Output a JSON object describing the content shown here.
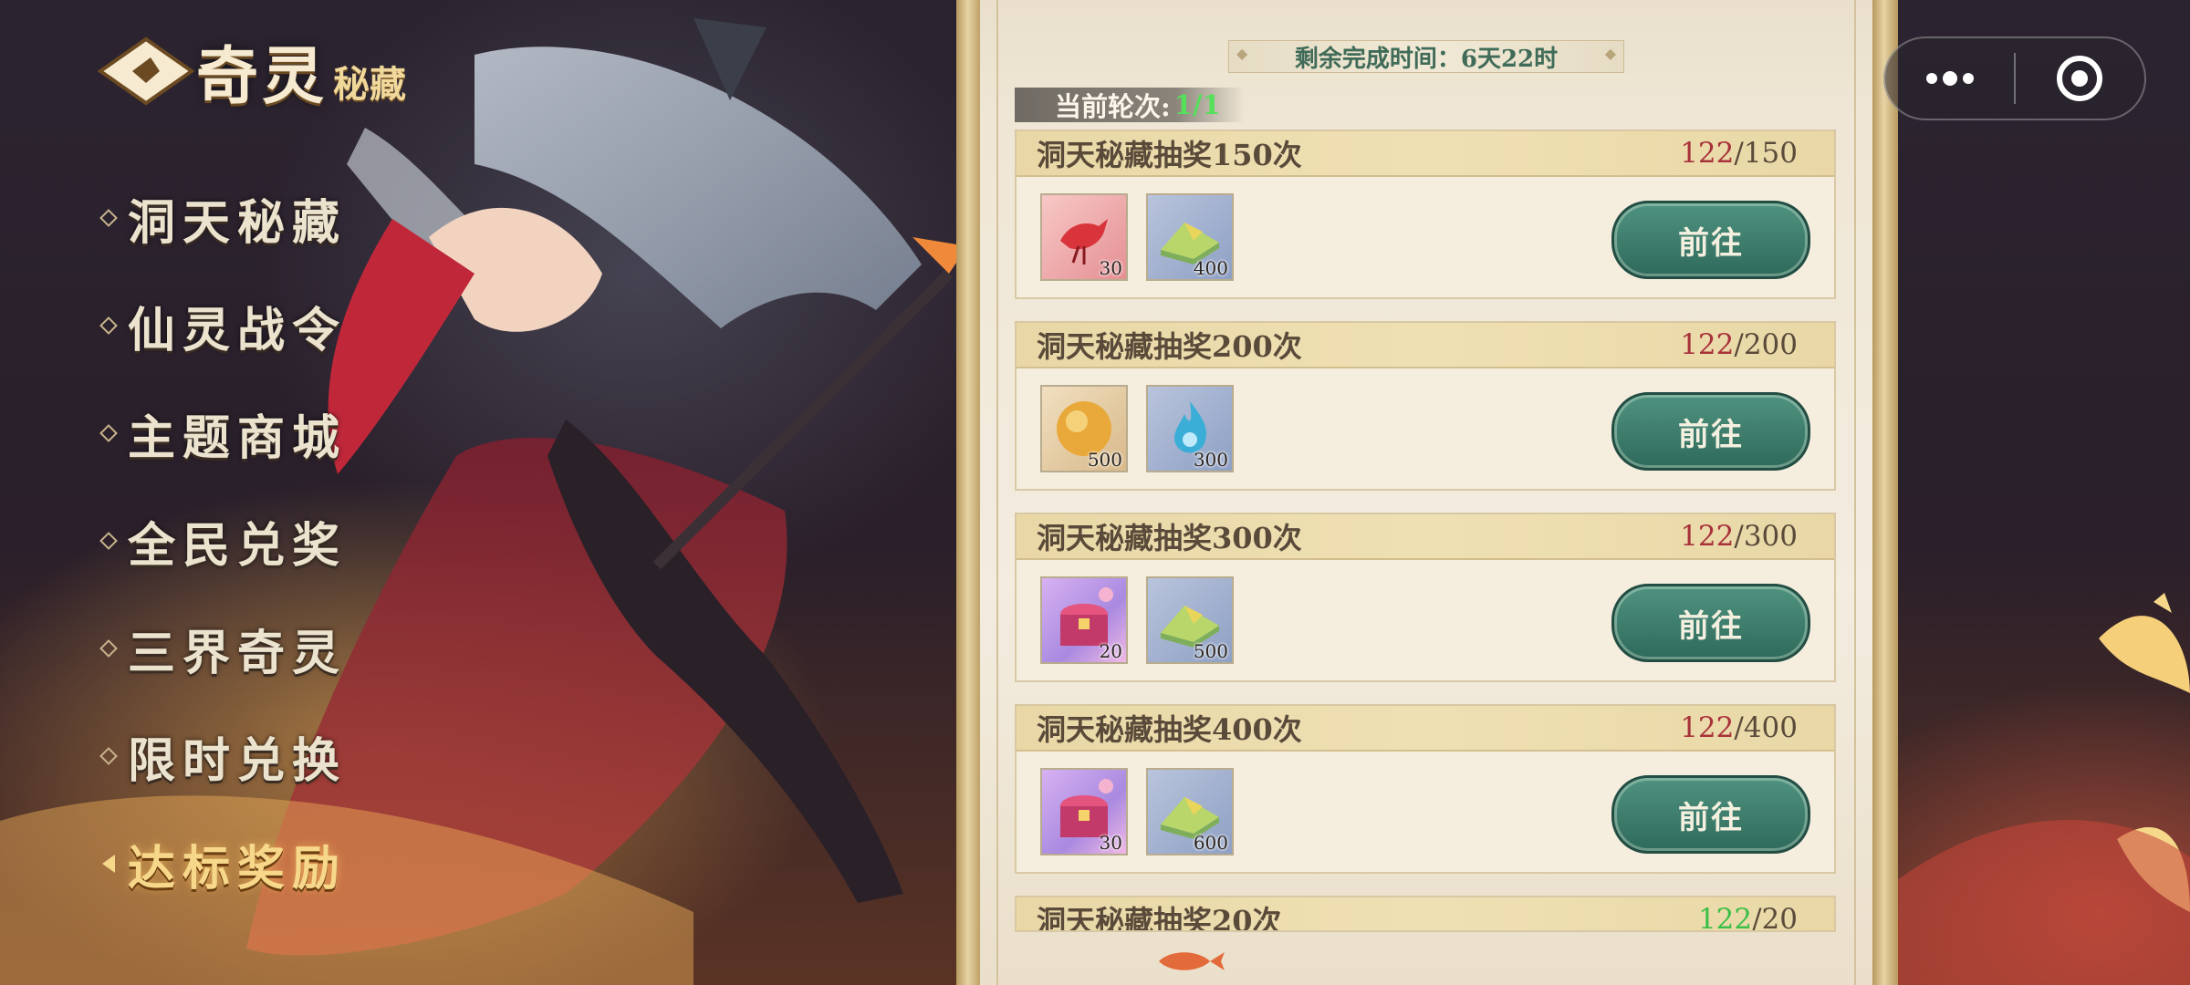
{
  "logo": {
    "title": "奇灵",
    "subtitle": "秘藏"
  },
  "menu": [
    {
      "label": "洞天秘藏",
      "active": false
    },
    {
      "label": "仙灵战令",
      "active": false
    },
    {
      "label": "主题商城",
      "active": false
    },
    {
      "label": "全民兑奖",
      "active": false
    },
    {
      "label": "三界奇灵",
      "active": false
    },
    {
      "label": "限时兑换",
      "active": false
    },
    {
      "label": "达标奖励",
      "active": true
    }
  ],
  "panel": {
    "timer": "剩余完成时间：6天22时",
    "round_label": "当前轮次:",
    "round_value": "1/1",
    "tasks": [
      {
        "title": "洞天秘藏抽奖150次",
        "current": "122",
        "target": "/150",
        "button": "前往",
        "rewards": [
          {
            "icon": "phoenix-feather-icon",
            "qty": "30"
          },
          {
            "icon": "jade-pile-icon",
            "qty": "400"
          }
        ]
      },
      {
        "title": "洞天秘藏抽奖200次",
        "current": "122",
        "target": "/200",
        "button": "前往",
        "rewards": [
          {
            "icon": "golden-orb-icon",
            "qty": "500"
          },
          {
            "icon": "blue-flame-icon",
            "qty": "300"
          }
        ]
      },
      {
        "title": "洞天秘藏抽奖300次",
        "current": "122",
        "target": "/300",
        "button": "前往",
        "rewards": [
          {
            "icon": "treasure-chest-icon",
            "qty": "20"
          },
          {
            "icon": "jade-pile-icon",
            "qty": "500"
          }
        ]
      },
      {
        "title": "洞天秘藏抽奖400次",
        "current": "122",
        "target": "/400",
        "button": "前往",
        "rewards": [
          {
            "icon": "treasure-chest-icon",
            "qty": "30"
          },
          {
            "icon": "jade-pile-icon",
            "qty": "600"
          }
        ]
      },
      {
        "title": "洞天秘藏抽奖20次",
        "current": "122",
        "target": "/20"
      }
    ]
  },
  "colors": {
    "button": "#2f6a5b",
    "progress_incomplete": "#a8323a",
    "progress_complete": "#3bbf48",
    "round_value": "#55e05a"
  },
  "capsule": {
    "more_icon": "more-dots-icon",
    "close_icon": "target-circle-icon"
  }
}
